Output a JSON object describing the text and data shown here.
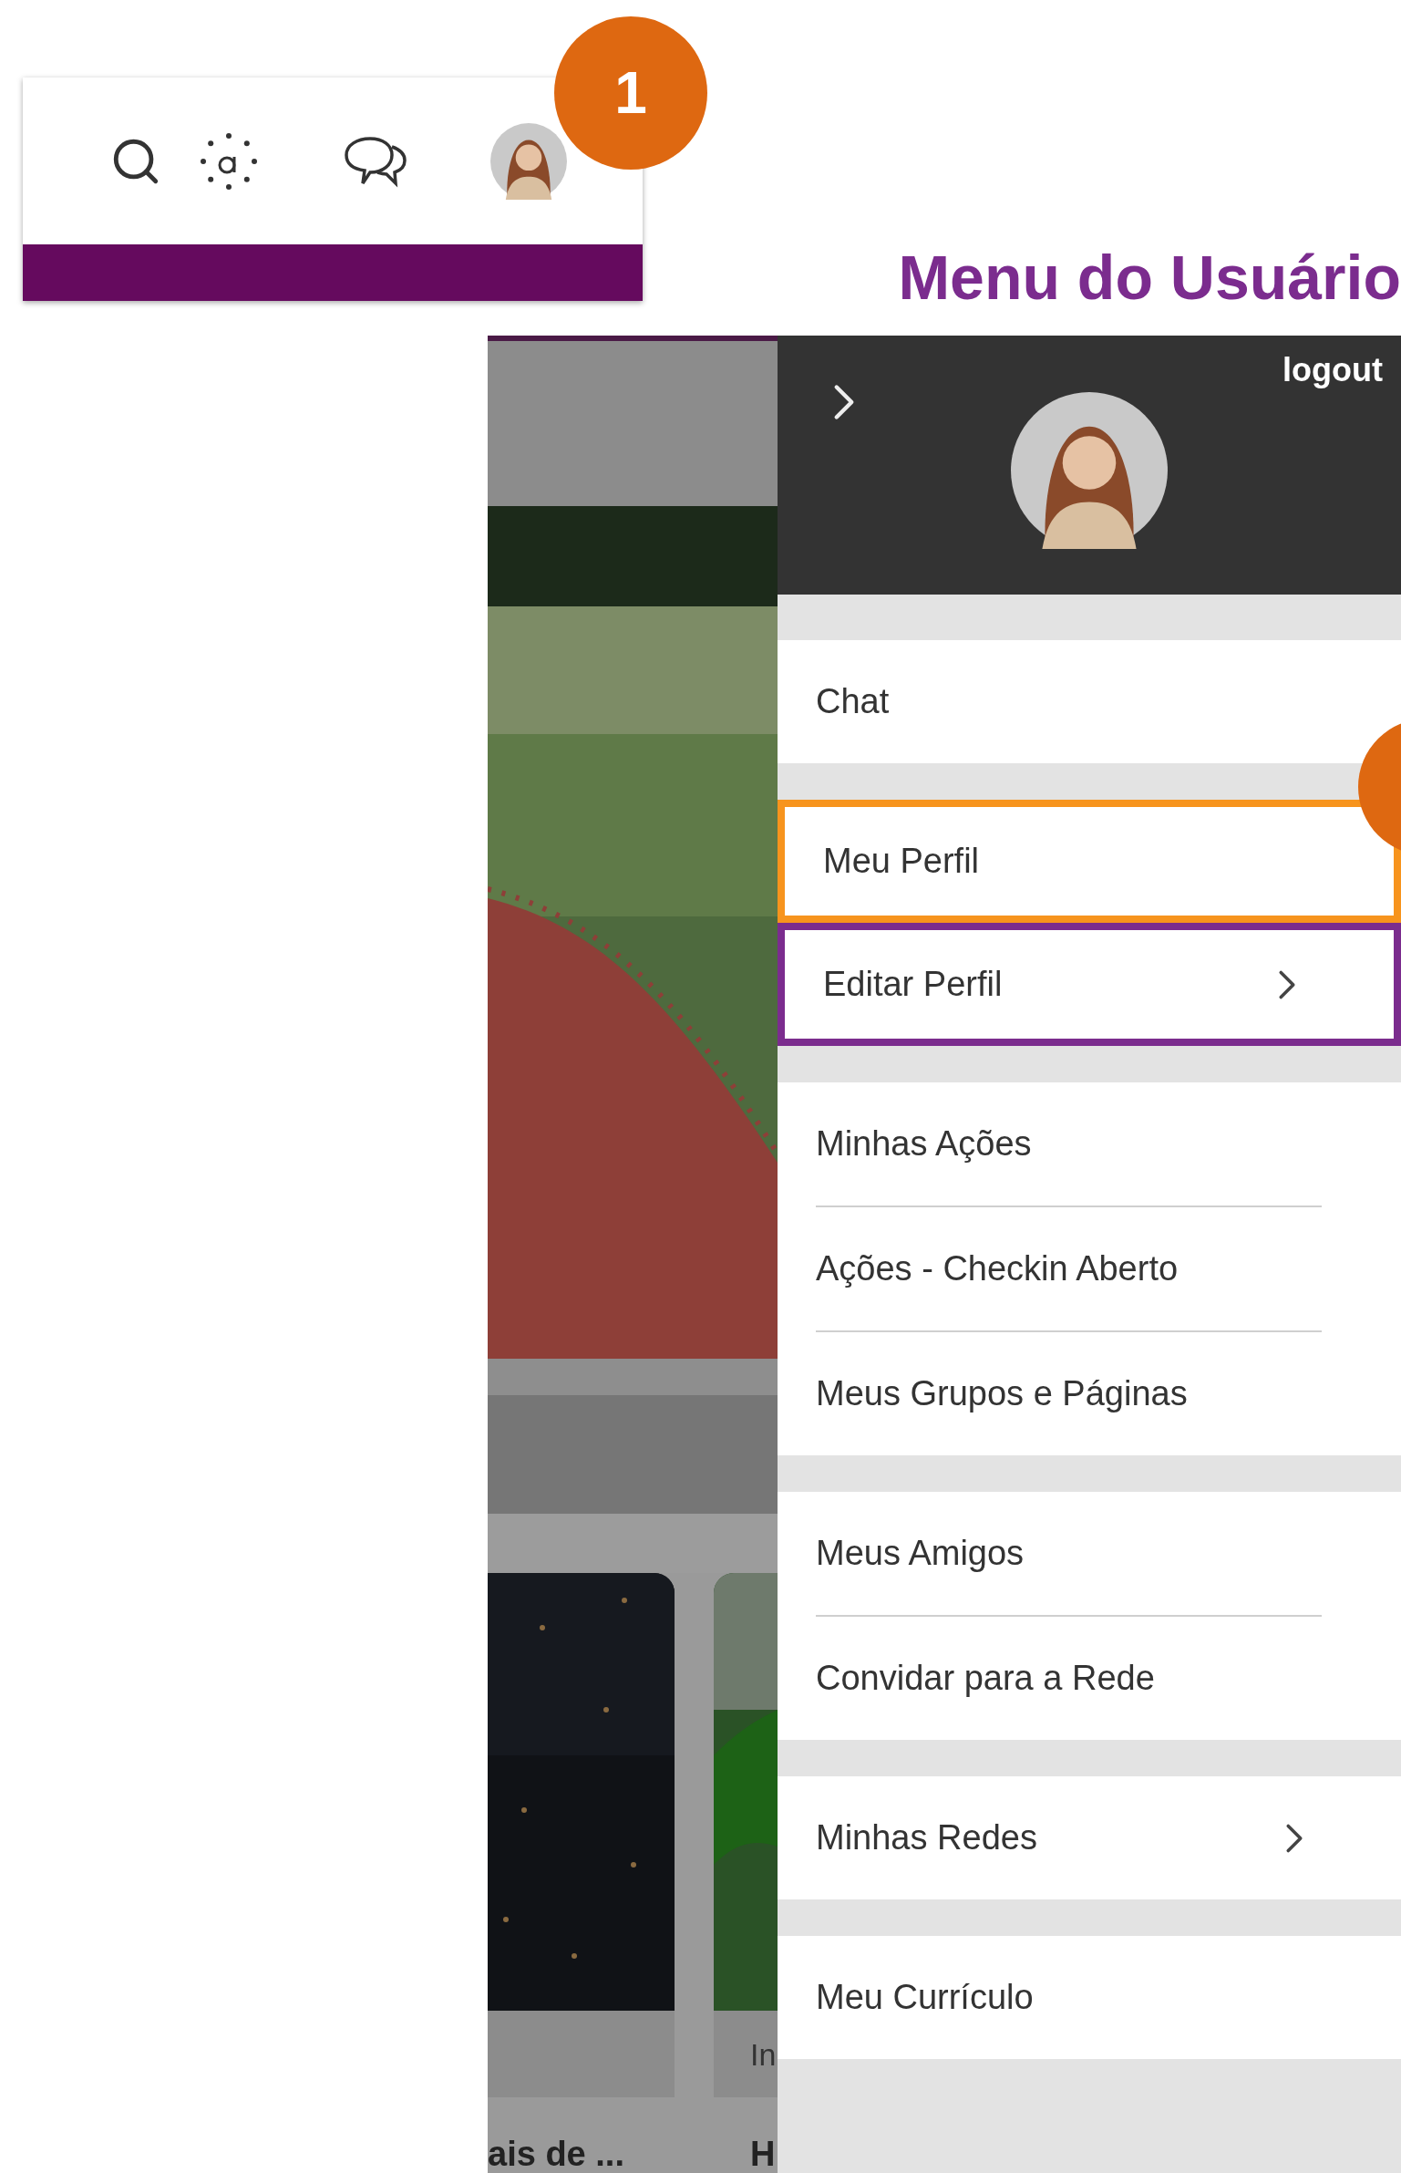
{
  "toolbar": {
    "badge": "1"
  },
  "heading": "Menu do Usuário",
  "background_page": {
    "card_1_title": "ais de ...",
    "card_2_label": "In",
    "card_2_title": "H"
  },
  "menu": {
    "logout": "logout",
    "side_badge": true,
    "groups": [
      [
        {
          "label": "Chat",
          "has_submenu": false
        }
      ],
      [
        {
          "label": "Meu Perfil",
          "color": "#f7941d",
          "has_submenu": false
        },
        {
          "label": "Editar Perfil",
          "color": "#7b2c8e",
          "has_submenu": true
        }
      ],
      [
        {
          "label": "Minhas Ações",
          "has_submenu": false
        },
        {
          "label": "Ações - Checkin Aberto",
          "has_submenu": false
        },
        {
          "label": "Meus Grupos e Páginas",
          "has_submenu": false
        }
      ],
      [
        {
          "label": "Meus Amigos",
          "has_submenu": false
        },
        {
          "label": "Convidar para a Rede",
          "has_submenu": false
        }
      ],
      [
        {
          "label": "Minhas Redes",
          "has_submenu": true
        }
      ],
      [
        {
          "label": "Meu Currículo",
          "has_submenu": false
        }
      ]
    ]
  }
}
